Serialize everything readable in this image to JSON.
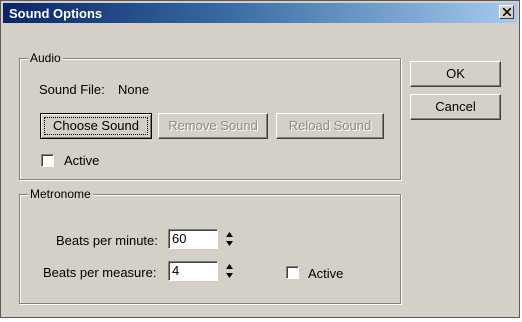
{
  "window": {
    "title": "Sound Options"
  },
  "audio": {
    "group_label": "Audio",
    "sound_file_label": "Sound File:",
    "sound_file_value": "None",
    "choose_sound": "Choose Sound",
    "remove_sound": "Remove Sound",
    "reload_sound": "Reload Sound",
    "active_label": "Active",
    "active_checked": false
  },
  "metronome": {
    "group_label": "Metronome",
    "bpm_label": "Beats per minute:",
    "bpm_value": "60",
    "bpmeasure_label": "Beats per measure:",
    "bpmeasure_value": "4",
    "active_label": "Active",
    "active_checked": false
  },
  "buttons": {
    "ok": "OK",
    "cancel": "Cancel"
  },
  "icons": {
    "close": "close-icon",
    "spinner": "spinner-arrows-icon"
  },
  "colors": {
    "title_bar_start": "#0a246a",
    "title_bar_end": "#a6caf0",
    "dialog_bg": "#d4d0c8"
  }
}
